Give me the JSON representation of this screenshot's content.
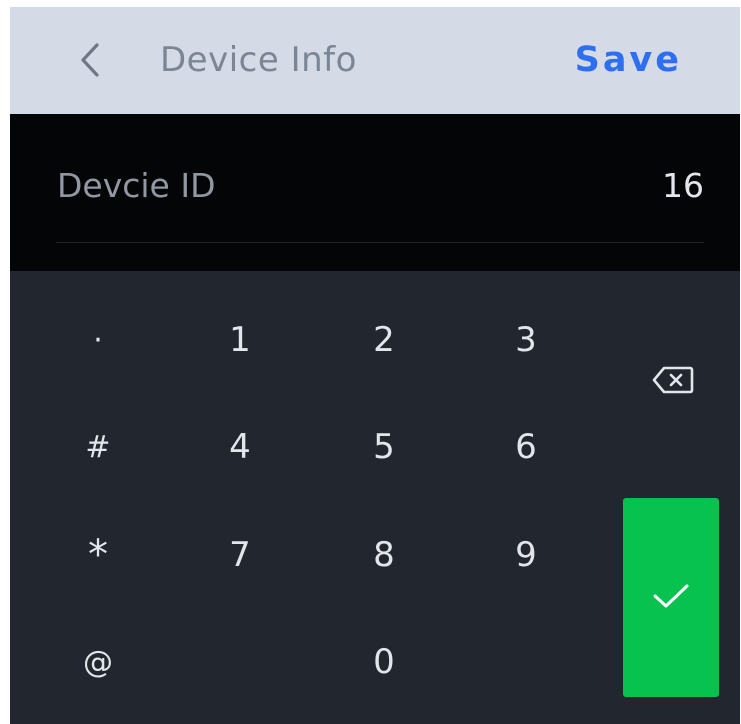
{
  "header": {
    "back_icon": "chevron-left-icon",
    "title": "Device Info",
    "save_label": "Save"
  },
  "field": {
    "label": "Devcie ID",
    "value": "16"
  },
  "keypad": {
    "keys": {
      "dot": "·",
      "one": "1",
      "two": "2",
      "three": "3",
      "hash": "#",
      "four": "4",
      "five": "5",
      "six": "6",
      "star": "*",
      "seven": "7",
      "eight": "8",
      "nine": "9",
      "at": "@",
      "zero": "0"
    },
    "backspace_icon": "backspace-icon",
    "confirm_icon": "check-icon"
  },
  "colors": {
    "header_bg": "#d4dbe7",
    "save_blue": "#2e6ef0",
    "field_bg": "#040507",
    "keypad_bg": "#22262e",
    "confirm_green": "#08c250"
  }
}
